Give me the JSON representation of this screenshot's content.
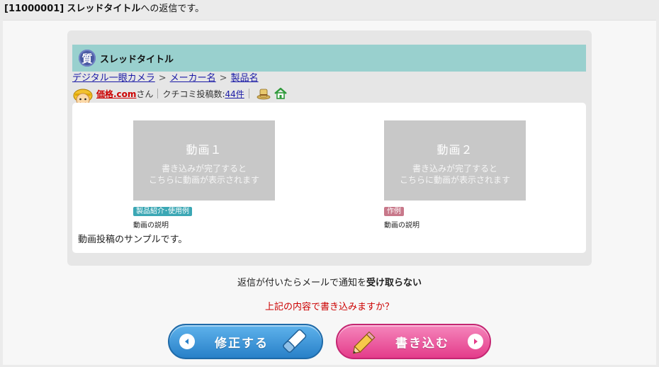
{
  "header": {
    "thread_id": "[11000001]",
    "thread_title": "スレッドタイトル",
    "suffix": "への返信です。"
  },
  "thread": {
    "badge": "質",
    "title": "スレッドタイトル"
  },
  "breadcrumb": [
    "デジタル一眼カメラ",
    "メーカー名",
    "製品名"
  ],
  "breadcrumb_separator": ">",
  "user": {
    "name": "価格.com",
    "suffix": "さん",
    "post_count_label": "クチコミ投稿数:",
    "post_count": "44件"
  },
  "videos": [
    {
      "title": "動画１",
      "message_line1": "書き込みが完了すると",
      "message_line2": "こちらに動画が表示されます",
      "tag": "製品紹介･使用例",
      "description": "動画の説明"
    },
    {
      "title": "動画２",
      "message_line1": "書き込みが完了すると",
      "message_line2": "こちらに動画が表示されます",
      "tag": "作例",
      "description": "動画の説明"
    }
  ],
  "body_text": "動画投稿のサンプルです。",
  "notify": {
    "prefix": "返信が付いたらメールで通知を",
    "emphasis": "受け取らない"
  },
  "confirm_text": "上記の内容で書き込みますか？",
  "buttons": {
    "edit_label": "修正する",
    "write_label": "書き込む"
  },
  "colors": {
    "title_bar": "#99d0ce",
    "edit_button": "#2880c8",
    "write_button": "#e43c8a",
    "confirm_text": "#cc0000"
  },
  "icons": {
    "badge": "question-badge-icon",
    "avatar": "user-avatar-icon",
    "hat": "hat-icon",
    "home": "home-icon",
    "back": "back-arrow-icon",
    "forward": "forward-arrow-icon",
    "eraser": "eraser-icon",
    "pencil": "pencil-icon"
  }
}
